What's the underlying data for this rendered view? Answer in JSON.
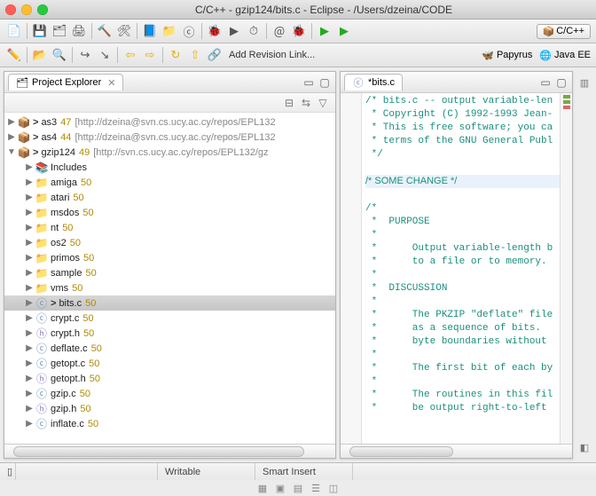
{
  "window": {
    "title": "C/C++ - gzip124/bits.c - Eclipse - /Users/dzeina/CODE"
  },
  "toolbar": {
    "add_revision": "Add Revision Link...",
    "perspective_label": "C/C++",
    "papyrus": "Papyrus",
    "javaee": "Java EE"
  },
  "explorer": {
    "tab_label": "Project Explorer",
    "roots": [
      {
        "name": "as3",
        "rev": "47",
        "url": "[http://dzeina@svn.cs.ucy.ac.cy/repos/EPL132",
        "dirty": true
      },
      {
        "name": "as4",
        "rev": "44",
        "url": "[http://dzeina@svn.cs.ucy.ac.cy/repos/EPL132",
        "dirty": true
      },
      {
        "name": "gzip124",
        "rev": "49",
        "url": "[http://svn.cs.ucy.ac.cy/repos/EPL132/gz",
        "dirty": true,
        "expanded": true
      }
    ],
    "children": [
      {
        "kind": "inc",
        "name": "Includes",
        "rev": ""
      },
      {
        "kind": "dir",
        "name": "amiga",
        "rev": "50"
      },
      {
        "kind": "dir",
        "name": "atari",
        "rev": "50"
      },
      {
        "kind": "dir",
        "name": "msdos",
        "rev": "50"
      },
      {
        "kind": "dir",
        "name": "nt",
        "rev": "50"
      },
      {
        "kind": "dir",
        "name": "os2",
        "rev": "50"
      },
      {
        "kind": "dir",
        "name": "primos",
        "rev": "50"
      },
      {
        "kind": "dir",
        "name": "sample",
        "rev": "50"
      },
      {
        "kind": "dir",
        "name": "vms",
        "rev": "50"
      },
      {
        "kind": "c",
        "name": "bits.c",
        "rev": "50",
        "sel": true,
        "dirty": true
      },
      {
        "kind": "c",
        "name": "crypt.c",
        "rev": "50"
      },
      {
        "kind": "h",
        "name": "crypt.h",
        "rev": "50"
      },
      {
        "kind": "c",
        "name": "deflate.c",
        "rev": "50"
      },
      {
        "kind": "c",
        "name": "getopt.c",
        "rev": "50"
      },
      {
        "kind": "h",
        "name": "getopt.h",
        "rev": "50"
      },
      {
        "kind": "c",
        "name": "gzip.c",
        "rev": "50"
      },
      {
        "kind": "h",
        "name": "gzip.h",
        "rev": "50"
      },
      {
        "kind": "c",
        "name": "inflate.c",
        "rev": "50"
      }
    ]
  },
  "editor": {
    "tab_label": "*bits.c",
    "lines": [
      "/* bits.c -- output variable-len",
      " * Copyright (C) 1992-1993 Jean-",
      " * This is free software; you ca",
      " * terms of the GNU General Publ",
      " */",
      "",
      "/* SOME CHANGE */",
      "",
      "/*",
      " *  PURPOSE",
      " *",
      " *      Output variable-length b",
      " *      to a file or to memory.",
      " *",
      " *  DISCUSSION",
      " *",
      " *      The PKZIP \"deflate\" file",
      " *      as a sequence of bits.  ",
      " *      byte boundaries without ",
      " *",
      " *      The first bit of each by",
      " *",
      " *      The routines in this fil",
      " *      be output right-to-left "
    ],
    "highlight_index": 6
  },
  "status": {
    "writable": "Writable",
    "smartinsert": "Smart Insert"
  }
}
